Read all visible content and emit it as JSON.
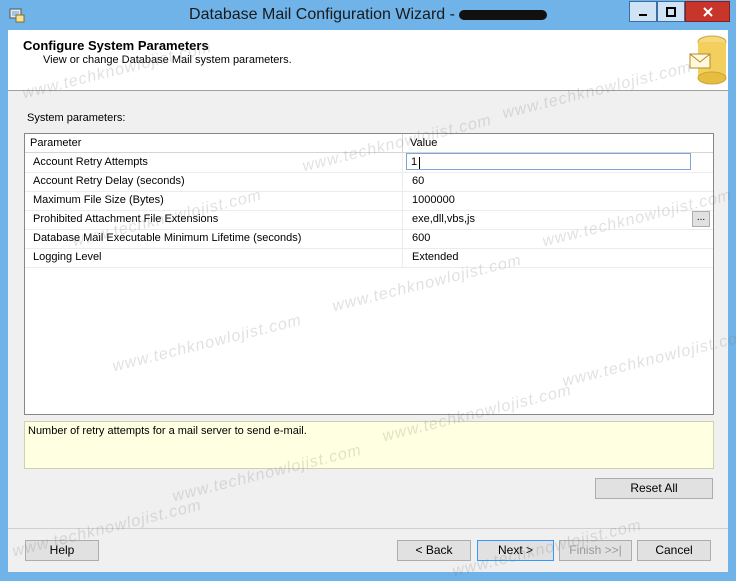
{
  "window": {
    "title": "Database Mail Configuration Wizard -"
  },
  "header": {
    "title": "Configure System Parameters",
    "subtitle": "View or change Database Mail system parameters."
  },
  "system_params_label": "System parameters:",
  "grid": {
    "col_param": "Parameter",
    "col_value": "Value",
    "rows": [
      {
        "name": "Account Retry Attempts",
        "value": "1"
      },
      {
        "name": "Account Retry Delay (seconds)",
        "value": "60"
      },
      {
        "name": "Maximum File Size (Bytes)",
        "value": "1000000"
      },
      {
        "name": "Prohibited Attachment File Extensions",
        "value": "exe,dll,vbs,js"
      },
      {
        "name": "Database Mail Executable Minimum Lifetime (seconds)",
        "value": "600"
      },
      {
        "name": "Logging Level",
        "value": "Extended"
      }
    ],
    "ellipsis_label": "..."
  },
  "description": "Number of retry attempts for a mail server to send e-mail.",
  "buttons": {
    "reset_all": "Reset All",
    "help": "Help",
    "back": "< Back",
    "next": "Next >",
    "finish": "Finish >>|",
    "cancel": "Cancel"
  },
  "watermark": "www.techknowlojist.com"
}
